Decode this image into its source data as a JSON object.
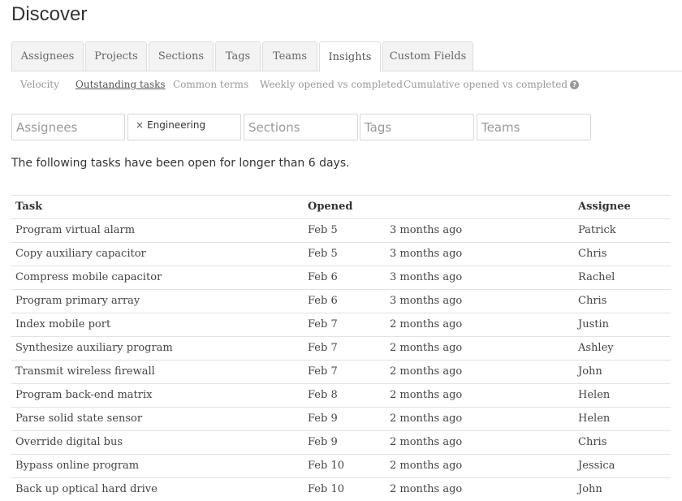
{
  "page": {
    "title": "Discover"
  },
  "tabs": [
    {
      "label": "Assignees",
      "active": false
    },
    {
      "label": "Projects",
      "active": false
    },
    {
      "label": "Sections",
      "active": false
    },
    {
      "label": "Tags",
      "active": false
    },
    {
      "label": "Teams",
      "active": false
    },
    {
      "label": "Insights",
      "active": true
    },
    {
      "label": "Custom Fields",
      "active": false
    }
  ],
  "subnav": [
    {
      "label": "Velocity",
      "active": false
    },
    {
      "label": "Outstanding tasks",
      "active": true
    },
    {
      "label": "Common terms",
      "active": false
    },
    {
      "label": "Weekly opened vs completed",
      "active": false
    },
    {
      "label": "Cumulative opened vs completed",
      "active": false,
      "icon": "help-icon"
    }
  ],
  "filters": {
    "assignees": {
      "placeholder": "Assignees"
    },
    "projects": {
      "chip_remove": "×",
      "chip_value": "Engineering"
    },
    "sections": {
      "placeholder": "Sections"
    },
    "tags": {
      "placeholder": "Tags"
    },
    "teams": {
      "placeholder": "Teams"
    }
  },
  "notice": "The following tasks have been open for longer than 6 days.",
  "table": {
    "headers": {
      "task": "Task",
      "opened": "Opened",
      "assignee": "Assignee"
    },
    "rows": [
      {
        "task": "Program virtual alarm",
        "opened": "Feb 5",
        "ago": "3 months ago",
        "assignee": "Patrick"
      },
      {
        "task": "Copy auxiliary capacitor",
        "opened": "Feb 5",
        "ago": "3 months ago",
        "assignee": "Chris"
      },
      {
        "task": "Compress mobile capacitor",
        "opened": "Feb 6",
        "ago": "3 months ago",
        "assignee": "Rachel"
      },
      {
        "task": "Program primary array",
        "opened": "Feb 6",
        "ago": "3 months ago",
        "assignee": "Chris"
      },
      {
        "task": "Index mobile port",
        "opened": "Feb 7",
        "ago": "2 months ago",
        "assignee": "Justin"
      },
      {
        "task": "Synthesize auxiliary program",
        "opened": "Feb 7",
        "ago": "2 months ago",
        "assignee": "Ashley"
      },
      {
        "task": "Transmit wireless firewall",
        "opened": "Feb 7",
        "ago": "2 months ago",
        "assignee": "John"
      },
      {
        "task": "Program back-end matrix",
        "opened": "Feb 8",
        "ago": "2 months ago",
        "assignee": "Helen"
      },
      {
        "task": "Parse solid state sensor",
        "opened": "Feb 9",
        "ago": "2 months ago",
        "assignee": "Helen"
      },
      {
        "task": "Override digital bus",
        "opened": "Feb 9",
        "ago": "2 months ago",
        "assignee": "Chris"
      },
      {
        "task": "Bypass online program",
        "opened": "Feb 10",
        "ago": "2 months ago",
        "assignee": "Jessica"
      },
      {
        "task": "Back up optical hard drive",
        "opened": "Feb 10",
        "ago": "2 months ago",
        "assignee": "John"
      }
    ]
  }
}
